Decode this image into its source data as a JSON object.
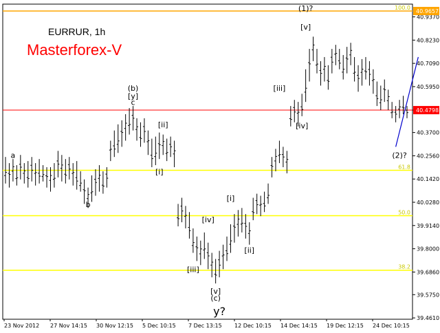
{
  "chart_data": {
    "type": "bar",
    "symbol_label": "EURRUR, 1h",
    "brand_label": "Masterforex-V",
    "ylim": [
      39.4545,
      40.9995
    ],
    "y_ticks": [
      "40.9370",
      "40.8230",
      "40.7090",
      "40.5950",
      "40.4798",
      "40.3700",
      "40.2560",
      "40.1420",
      "40.0280",
      "39.9140",
      "39.8000",
      "39.6860",
      "39.5750",
      "39.4610"
    ],
    "x_tick_labels": [
      "23 Nov 2012",
      "27 Nov 14:15",
      "30 Nov 12:15",
      "5 Dec 10:15",
      "7 Dec 13:15",
      "12 Dec 10:15",
      "14 Dec 14:15",
      "19 Dec 12:15",
      "24 Dec 10:15"
    ],
    "price_line": {
      "value": 40.4798,
      "label": "40.4798",
      "color": "#ff0000"
    },
    "top_line": {
      "value": 40.9657,
      "label": "40.9657",
      "color": "#ffa500"
    },
    "fib_levels": [
      {
        "value": 40.9657,
        "label": "100.0",
        "color": "#ffa500"
      },
      {
        "value": 40.185,
        "label": "61.8",
        "color": "#ffff00"
      },
      {
        "value": 39.962,
        "label": "50.0",
        "color": "#ffff00"
      },
      {
        "value": 39.695,
        "label": "38.2",
        "color": "#ffff00"
      }
    ],
    "series_bars": [
      {
        "low": 40.12,
        "high": 40.25
      },
      {
        "low": 40.1,
        "high": 40.22
      },
      {
        "low": 40.13,
        "high": 40.24
      },
      {
        "low": 40.11,
        "high": 40.21
      },
      {
        "low": 40.14,
        "high": 40.26
      },
      {
        "low": 40.12,
        "high": 40.22
      },
      {
        "low": 40.1,
        "high": 40.23
      },
      {
        "low": 40.13,
        "high": 40.25
      },
      {
        "low": 40.11,
        "high": 40.22
      },
      {
        "low": 40.12,
        "high": 40.24
      },
      {
        "low": 40.13,
        "high": 40.21
      },
      {
        "low": 40.1,
        "high": 40.2
      },
      {
        "low": 40.08,
        "high": 40.2
      },
      {
        "low": 40.1,
        "high": 40.22
      },
      {
        "low": 40.15,
        "high": 40.28
      },
      {
        "low": 40.13,
        "high": 40.26
      },
      {
        "low": 40.12,
        "high": 40.24
      },
      {
        "low": 40.14,
        "high": 40.25
      },
      {
        "low": 40.11,
        "high": 40.22
      },
      {
        "low": 40.09,
        "high": 40.23
      },
      {
        "low": 40.08,
        "high": 40.18
      },
      {
        "low": 40.02,
        "high": 40.14
      },
      {
        "low": 40.0,
        "high": 40.1
      },
      {
        "low": 40.03,
        "high": 40.16
      },
      {
        "low": 40.06,
        "high": 40.19
      },
      {
        "low": 40.08,
        "high": 40.21
      },
      {
        "low": 40.07,
        "high": 40.18
      },
      {
        "low": 40.1,
        "high": 40.2
      },
      {
        "low": 40.23,
        "high": 40.33
      },
      {
        "low": 40.25,
        "high": 40.38
      },
      {
        "low": 40.27,
        "high": 40.41
      },
      {
        "low": 40.3,
        "high": 40.43
      },
      {
        "low": 40.33,
        "high": 40.46
      },
      {
        "low": 40.36,
        "high": 40.49
      },
      {
        "low": 40.38,
        "high": 40.5
      },
      {
        "low": 40.33,
        "high": 40.44
      },
      {
        "low": 40.3,
        "high": 40.42
      },
      {
        "low": 40.32,
        "high": 40.44
      },
      {
        "low": 40.26,
        "high": 40.38
      },
      {
        "low": 40.2,
        "high": 40.34
      },
      {
        "low": 40.21,
        "high": 40.35
      },
      {
        "low": 40.24,
        "high": 40.37
      },
      {
        "low": 40.26,
        "high": 40.36
      },
      {
        "low": 40.23,
        "high": 40.34
      },
      {
        "low": 40.25,
        "high": 40.35
      },
      {
        "low": 40.2,
        "high": 40.33
      },
      {
        "low": 39.91,
        "high": 40.02
      },
      {
        "low": 39.93,
        "high": 40.05
      },
      {
        "low": 39.9,
        "high": 40.01
      },
      {
        "low": 39.85,
        "high": 39.98
      },
      {
        "low": 39.78,
        "high": 39.9
      },
      {
        "low": 39.74,
        "high": 39.86
      },
      {
        "low": 39.72,
        "high": 39.84
      },
      {
        "low": 39.75,
        "high": 39.88
      },
      {
        "low": 39.7,
        "high": 39.83
      },
      {
        "low": 39.66,
        "high": 39.78
      },
      {
        "low": 39.63,
        "high": 39.75
      },
      {
        "low": 39.66,
        "high": 39.79
      },
      {
        "low": 39.7,
        "high": 39.82
      },
      {
        "low": 39.74,
        "high": 39.86
      },
      {
        "low": 39.78,
        "high": 39.92
      },
      {
        "low": 39.83,
        "high": 39.97
      },
      {
        "low": 39.86,
        "high": 39.99
      },
      {
        "low": 39.88,
        "high": 40.0
      },
      {
        "low": 39.85,
        "high": 39.97
      },
      {
        "low": 39.82,
        "high": 39.93
      },
      {
        "low": 39.94,
        "high": 40.05
      },
      {
        "low": 39.97,
        "high": 40.07
      },
      {
        "low": 39.96,
        "high": 40.06
      },
      {
        "low": 39.98,
        "high": 40.08
      },
      {
        "low": 40.02,
        "high": 40.12
      },
      {
        "low": 40.15,
        "high": 40.25
      },
      {
        "low": 40.18,
        "high": 40.29
      },
      {
        "low": 40.22,
        "high": 40.33
      },
      {
        "low": 40.2,
        "high": 40.3
      },
      {
        "low": 40.17,
        "high": 40.28
      },
      {
        "low": 40.4,
        "high": 40.5
      },
      {
        "low": 40.42,
        "high": 40.53
      },
      {
        "low": 40.4,
        "high": 40.52
      },
      {
        "low": 40.45,
        "high": 40.56
      },
      {
        "low": 40.52,
        "high": 40.68
      },
      {
        "low": 40.62,
        "high": 40.78
      },
      {
        "low": 40.72,
        "high": 40.84
      },
      {
        "low": 40.66,
        "high": 40.78
      },
      {
        "low": 40.6,
        "high": 40.72
      },
      {
        "low": 40.62,
        "high": 40.74
      },
      {
        "low": 40.58,
        "high": 40.7
      },
      {
        "low": 40.66,
        "high": 40.78
      },
      {
        "low": 40.7,
        "high": 40.8
      },
      {
        "low": 40.68,
        "high": 40.78
      },
      {
        "low": 40.63,
        "high": 40.75
      },
      {
        "low": 40.66,
        "high": 40.79
      },
      {
        "low": 40.7,
        "high": 40.81
      },
      {
        "low": 40.62,
        "high": 40.74
      },
      {
        "low": 40.57,
        "high": 40.7
      },
      {
        "low": 40.6,
        "high": 40.73
      },
      {
        "low": 40.63,
        "high": 40.74
      },
      {
        "low": 40.6,
        "high": 40.72
      },
      {
        "low": 40.56,
        "high": 40.68
      },
      {
        "low": 40.5,
        "high": 40.62
      },
      {
        "low": 40.48,
        "high": 40.6
      },
      {
        "low": 40.52,
        "high": 40.63
      },
      {
        "low": 40.48,
        "high": 40.58
      },
      {
        "low": 40.44,
        "high": 40.52
      },
      {
        "low": 40.42,
        "high": 40.5
      },
      {
        "low": 40.44,
        "high": 40.53
      },
      {
        "low": 40.46,
        "high": 40.55
      },
      {
        "low": 40.44,
        "high": 40.5
      }
    ],
    "wave_labels": [
      {
        "text": "a",
        "x": 2,
        "y": 40.245
      },
      {
        "text": "b",
        "x": 22,
        "y": 40.005
      },
      {
        "text": "(b)",
        "x": 34,
        "y": 40.575
      },
      {
        "text": "[y]",
        "x": 34,
        "y": 40.535
      },
      {
        "text": "c",
        "x": 34,
        "y": 40.505
      },
      {
        "text": "[ii]",
        "x": 42,
        "y": 40.395
      },
      {
        "text": "[i]",
        "x": 41,
        "y": 40.165
      },
      {
        "text": "[iv]",
        "x": 54,
        "y": 39.93
      },
      {
        "text": "[iii]",
        "x": 50,
        "y": 39.685
      },
      {
        "text": "[v]",
        "x": 56,
        "y": 39.58
      },
      {
        "text": "(c)",
        "x": 56,
        "y": 39.545
      },
      {
        "text": "y?",
        "x": 57,
        "y": 39.475
      },
      {
        "text": "[i]",
        "x": 60,
        "y": 40.035
      },
      {
        "text": "[ii]",
        "x": 65,
        "y": 39.78
      },
      {
        "text": "[iii]",
        "x": 73,
        "y": 40.575
      },
      {
        "text": "[iv]",
        "x": 79,
        "y": 40.39
      },
      {
        "text": "[v]",
        "x": 80,
        "y": 40.875
      },
      {
        "text": "(1)?",
        "x": 80,
        "y": 40.965
      },
      {
        "text": "(2)?",
        "x": 105,
        "y": 40.245
      }
    ],
    "projection_line": {
      "x1": 104,
      "y1": 40.3,
      "x2": 110,
      "y2": 40.74,
      "color": "#0000cc"
    }
  }
}
